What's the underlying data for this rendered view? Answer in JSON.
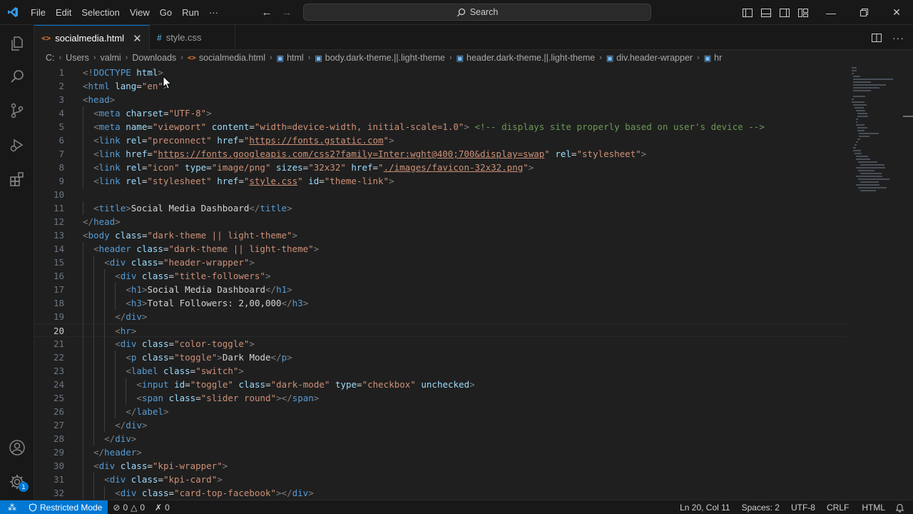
{
  "menu": {
    "items": [
      "File",
      "Edit",
      "Selection",
      "View",
      "Go",
      "Run",
      "···"
    ]
  },
  "search": {
    "label": "Search"
  },
  "tabs": [
    {
      "label": "socialmedia.html",
      "icon": "html-file-icon",
      "active": true
    },
    {
      "label": "style.css",
      "icon": "css-file-icon",
      "active": false
    }
  ],
  "breadcrumb": [
    "C:",
    "Users",
    "valmi",
    "Downloads",
    "socialmedia.html",
    "html",
    "body.dark-theme.||.light-theme",
    "header.dark-theme.||.light-theme",
    "div.header-wrapper",
    "hr"
  ],
  "editor": {
    "current_line": 20,
    "lines": [
      {
        "n": "1",
        "indent": 0,
        "tokens": [
          [
            "p",
            "<!"
          ],
          [
            "doc",
            "DOCTYPE"
          ],
          [
            "txt",
            " "
          ],
          [
            "attr",
            "html"
          ],
          [
            "p",
            ">"
          ]
        ]
      },
      {
        "n": "2",
        "indent": 0,
        "tokens": [
          [
            "p",
            "<"
          ],
          [
            "tag",
            "html"
          ],
          [
            "txt",
            " "
          ],
          [
            "attr",
            "lang"
          ],
          [
            "txt",
            "="
          ],
          [
            "str",
            "\"en\""
          ],
          [
            "p",
            ">"
          ]
        ]
      },
      {
        "n": "3",
        "indent": 0,
        "tokens": [
          [
            "p",
            "<"
          ],
          [
            "tag",
            "head"
          ],
          [
            "p",
            ">"
          ]
        ]
      },
      {
        "n": "4",
        "indent": 1,
        "tokens": [
          [
            "p",
            "<"
          ],
          [
            "tag",
            "meta"
          ],
          [
            "txt",
            " "
          ],
          [
            "attr",
            "charset"
          ],
          [
            "txt",
            "="
          ],
          [
            "str",
            "\"UTF-8\""
          ],
          [
            "p",
            ">"
          ]
        ]
      },
      {
        "n": "5",
        "indent": 1,
        "tokens": [
          [
            "p",
            "<"
          ],
          [
            "tag",
            "meta"
          ],
          [
            "txt",
            " "
          ],
          [
            "attr",
            "name"
          ],
          [
            "txt",
            "="
          ],
          [
            "str",
            "\"viewport\""
          ],
          [
            "txt",
            " "
          ],
          [
            "attr",
            "content"
          ],
          [
            "txt",
            "="
          ],
          [
            "str",
            "\"width=device-width, initial-scale=1.0\""
          ],
          [
            "p",
            ">"
          ],
          [
            "txt",
            " "
          ],
          [
            "com",
            "<!-- displays site properly based on user's device -->"
          ]
        ]
      },
      {
        "n": "6",
        "indent": 1,
        "tokens": [
          [
            "p",
            "<"
          ],
          [
            "tag",
            "link"
          ],
          [
            "txt",
            " "
          ],
          [
            "attr",
            "rel"
          ],
          [
            "txt",
            "="
          ],
          [
            "str",
            "\"preconnect\""
          ],
          [
            "txt",
            " "
          ],
          [
            "attr",
            "href"
          ],
          [
            "txt",
            "="
          ],
          [
            "str",
            "\""
          ],
          [
            "link",
            "https://fonts.gstatic.com"
          ],
          [
            "str",
            "\""
          ],
          [
            "p",
            ">"
          ]
        ]
      },
      {
        "n": "7",
        "indent": 1,
        "tokens": [
          [
            "p",
            "<"
          ],
          [
            "tag",
            "link"
          ],
          [
            "txt",
            " "
          ],
          [
            "attr",
            "href"
          ],
          [
            "txt",
            "="
          ],
          [
            "str",
            "\""
          ],
          [
            "link",
            "https://fonts.googleapis.com/css2?family=Inter:wght@400;700&display=swap"
          ],
          [
            "str",
            "\""
          ],
          [
            "txt",
            " "
          ],
          [
            "attr",
            "rel"
          ],
          [
            "txt",
            "="
          ],
          [
            "str",
            "\"stylesheet\""
          ],
          [
            "p",
            ">"
          ]
        ]
      },
      {
        "n": "8",
        "indent": 1,
        "tokens": [
          [
            "p",
            "<"
          ],
          [
            "tag",
            "link"
          ],
          [
            "txt",
            " "
          ],
          [
            "attr",
            "rel"
          ],
          [
            "txt",
            "="
          ],
          [
            "str",
            "\"icon\""
          ],
          [
            "txt",
            " "
          ],
          [
            "attr",
            "type"
          ],
          [
            "txt",
            "="
          ],
          [
            "str",
            "\"image/png\""
          ],
          [
            "txt",
            " "
          ],
          [
            "attr",
            "sizes"
          ],
          [
            "txt",
            "="
          ],
          [
            "str",
            "\"32x32\""
          ],
          [
            "txt",
            " "
          ],
          [
            "attr",
            "href"
          ],
          [
            "txt",
            "="
          ],
          [
            "str",
            "\""
          ],
          [
            "link",
            "./images/favicon-32x32.png"
          ],
          [
            "str",
            "\""
          ],
          [
            "p",
            ">"
          ]
        ]
      },
      {
        "n": "9",
        "indent": 1,
        "tokens": [
          [
            "p",
            "<"
          ],
          [
            "tag",
            "link"
          ],
          [
            "txt",
            " "
          ],
          [
            "attr",
            "rel"
          ],
          [
            "txt",
            "="
          ],
          [
            "str",
            "\"stylesheet\""
          ],
          [
            "txt",
            " "
          ],
          [
            "attr",
            "href"
          ],
          [
            "txt",
            "="
          ],
          [
            "str",
            "\""
          ],
          [
            "link",
            "style.css"
          ],
          [
            "str",
            "\""
          ],
          [
            "txt",
            " "
          ],
          [
            "attr",
            "id"
          ],
          [
            "txt",
            "="
          ],
          [
            "str",
            "\"theme-link\""
          ],
          [
            "p",
            ">"
          ]
        ]
      },
      {
        "n": "10",
        "indent": 0,
        "tokens": []
      },
      {
        "n": "11",
        "indent": 1,
        "tokens": [
          [
            "p",
            "<"
          ],
          [
            "tag",
            "title"
          ],
          [
            "p",
            ">"
          ],
          [
            "txt",
            "Social Media Dashboard"
          ],
          [
            "p",
            "</"
          ],
          [
            "tag",
            "title"
          ],
          [
            "p",
            ">"
          ]
        ]
      },
      {
        "n": "12",
        "indent": 0,
        "tokens": [
          [
            "p",
            "</"
          ],
          [
            "tag",
            "head"
          ],
          [
            "p",
            ">"
          ]
        ]
      },
      {
        "n": "13",
        "indent": 0,
        "tokens": [
          [
            "p",
            "<"
          ],
          [
            "tag",
            "body"
          ],
          [
            "txt",
            " "
          ],
          [
            "attr",
            "class"
          ],
          [
            "txt",
            "="
          ],
          [
            "str",
            "\"dark-theme || light-theme\""
          ],
          [
            "p",
            ">"
          ]
        ]
      },
      {
        "n": "14",
        "indent": 1,
        "tokens": [
          [
            "p",
            "<"
          ],
          [
            "tag",
            "header"
          ],
          [
            "txt",
            " "
          ],
          [
            "attr",
            "class"
          ],
          [
            "txt",
            "="
          ],
          [
            "str",
            "\"dark-theme || light-theme\""
          ],
          [
            "p",
            ">"
          ]
        ]
      },
      {
        "n": "15",
        "indent": 2,
        "tokens": [
          [
            "p",
            "<"
          ],
          [
            "tag",
            "div"
          ],
          [
            "txt",
            " "
          ],
          [
            "attr",
            "class"
          ],
          [
            "txt",
            "="
          ],
          [
            "str",
            "\"header-wrapper\""
          ],
          [
            "p",
            ">"
          ]
        ]
      },
      {
        "n": "16",
        "indent": 3,
        "tokens": [
          [
            "p",
            "<"
          ],
          [
            "tag",
            "div"
          ],
          [
            "txt",
            " "
          ],
          [
            "attr",
            "class"
          ],
          [
            "txt",
            "="
          ],
          [
            "str",
            "\"title-followers\""
          ],
          [
            "p",
            ">"
          ]
        ]
      },
      {
        "n": "17",
        "indent": 4,
        "tokens": [
          [
            "p",
            "<"
          ],
          [
            "tag",
            "h1"
          ],
          [
            "p",
            ">"
          ],
          [
            "txt",
            "Social Media Dashboard"
          ],
          [
            "p",
            "</"
          ],
          [
            "tag",
            "h1"
          ],
          [
            "p",
            ">"
          ]
        ]
      },
      {
        "n": "18",
        "indent": 4,
        "tokens": [
          [
            "p",
            "<"
          ],
          [
            "tag",
            "h3"
          ],
          [
            "p",
            ">"
          ],
          [
            "txt",
            "Total Followers: 2,00,000"
          ],
          [
            "p",
            "</"
          ],
          [
            "tag",
            "h3"
          ],
          [
            "p",
            ">"
          ]
        ]
      },
      {
        "n": "19",
        "indent": 3,
        "tokens": [
          [
            "p",
            "</"
          ],
          [
            "tag",
            "div"
          ],
          [
            "p",
            ">"
          ]
        ]
      },
      {
        "n": "20",
        "indent": 3,
        "tokens": [
          [
            "p",
            "<"
          ],
          [
            "tag",
            "hr"
          ],
          [
            "p",
            ">"
          ]
        ]
      },
      {
        "n": "21",
        "indent": 3,
        "tokens": [
          [
            "p",
            "<"
          ],
          [
            "tag",
            "div"
          ],
          [
            "txt",
            " "
          ],
          [
            "attr",
            "class"
          ],
          [
            "txt",
            "="
          ],
          [
            "str",
            "\"color-toggle\""
          ],
          [
            "p",
            ">"
          ]
        ]
      },
      {
        "n": "22",
        "indent": 4,
        "tokens": [
          [
            "p",
            "<"
          ],
          [
            "tag",
            "p"
          ],
          [
            "txt",
            " "
          ],
          [
            "attr",
            "class"
          ],
          [
            "txt",
            "="
          ],
          [
            "str",
            "\"toggle\""
          ],
          [
            "p",
            ">"
          ],
          [
            "txt",
            "Dark Mode"
          ],
          [
            "p",
            "</"
          ],
          [
            "tag",
            "p"
          ],
          [
            "p",
            ">"
          ]
        ]
      },
      {
        "n": "23",
        "indent": 4,
        "tokens": [
          [
            "p",
            "<"
          ],
          [
            "tag",
            "label"
          ],
          [
            "txt",
            " "
          ],
          [
            "attr",
            "class"
          ],
          [
            "txt",
            "="
          ],
          [
            "str",
            "\"switch\""
          ],
          [
            "p",
            ">"
          ]
        ]
      },
      {
        "n": "24",
        "indent": 5,
        "tokens": [
          [
            "p",
            "<"
          ],
          [
            "tag",
            "input"
          ],
          [
            "txt",
            " "
          ],
          [
            "attr",
            "id"
          ],
          [
            "txt",
            "="
          ],
          [
            "str",
            "\"toggle\""
          ],
          [
            "txt",
            " "
          ],
          [
            "attr",
            "class"
          ],
          [
            "txt",
            "="
          ],
          [
            "str",
            "\"dark-mode\""
          ],
          [
            "txt",
            " "
          ],
          [
            "attr",
            "type"
          ],
          [
            "txt",
            "="
          ],
          [
            "str",
            "\"checkbox\""
          ],
          [
            "txt",
            " "
          ],
          [
            "attr",
            "unchecked"
          ],
          [
            "p",
            ">"
          ]
        ]
      },
      {
        "n": "25",
        "indent": 5,
        "tokens": [
          [
            "p",
            "<"
          ],
          [
            "tag",
            "span"
          ],
          [
            "txt",
            " "
          ],
          [
            "attr",
            "class"
          ],
          [
            "txt",
            "="
          ],
          [
            "str",
            "\"slider round\""
          ],
          [
            "p",
            "></"
          ],
          [
            "tag",
            "span"
          ],
          [
            "p",
            ">"
          ]
        ]
      },
      {
        "n": "26",
        "indent": 4,
        "tokens": [
          [
            "p",
            "</"
          ],
          [
            "tag",
            "label"
          ],
          [
            "p",
            ">"
          ]
        ]
      },
      {
        "n": "27",
        "indent": 3,
        "tokens": [
          [
            "p",
            "</"
          ],
          [
            "tag",
            "div"
          ],
          [
            "p",
            ">"
          ]
        ]
      },
      {
        "n": "28",
        "indent": 2,
        "tokens": [
          [
            "p",
            "</"
          ],
          [
            "tag",
            "div"
          ],
          [
            "p",
            ">"
          ]
        ]
      },
      {
        "n": "29",
        "indent": 1,
        "tokens": [
          [
            "p",
            "</"
          ],
          [
            "tag",
            "header"
          ],
          [
            "p",
            ">"
          ]
        ]
      },
      {
        "n": "30",
        "indent": 1,
        "tokens": [
          [
            "p",
            "<"
          ],
          [
            "tag",
            "div"
          ],
          [
            "txt",
            " "
          ],
          [
            "attr",
            "class"
          ],
          [
            "txt",
            "="
          ],
          [
            "str",
            "\"kpi-wrapper\""
          ],
          [
            "p",
            ">"
          ]
        ]
      },
      {
        "n": "31",
        "indent": 2,
        "tokens": [
          [
            "p",
            "<"
          ],
          [
            "tag",
            "div"
          ],
          [
            "txt",
            " "
          ],
          [
            "attr",
            "class"
          ],
          [
            "txt",
            "="
          ],
          [
            "str",
            "\"kpi-card\""
          ],
          [
            "p",
            ">"
          ]
        ]
      },
      {
        "n": "32",
        "indent": 3,
        "tokens": [
          [
            "p",
            "<"
          ],
          [
            "tag",
            "div"
          ],
          [
            "txt",
            " "
          ],
          [
            "attr",
            "class"
          ],
          [
            "txt",
            "="
          ],
          [
            "str",
            "\"card-top-facebook\""
          ],
          [
            "p",
            "></"
          ],
          [
            "tag",
            "div"
          ],
          [
            "p",
            ">"
          ]
        ]
      }
    ]
  },
  "statusbar": {
    "restricted": "Restricted Mode",
    "errors": "0",
    "warnings": "0",
    "ports": "0",
    "position": "Ln 20, Col 11",
    "spaces": "Spaces: 2",
    "encoding": "UTF-8",
    "eol": "CRLF",
    "language": "HTML"
  },
  "activity": {
    "settings_badge": "1"
  },
  "colors": {
    "accent": "#0078d4",
    "background": "#1f1f1f",
    "chrome": "#181818"
  }
}
